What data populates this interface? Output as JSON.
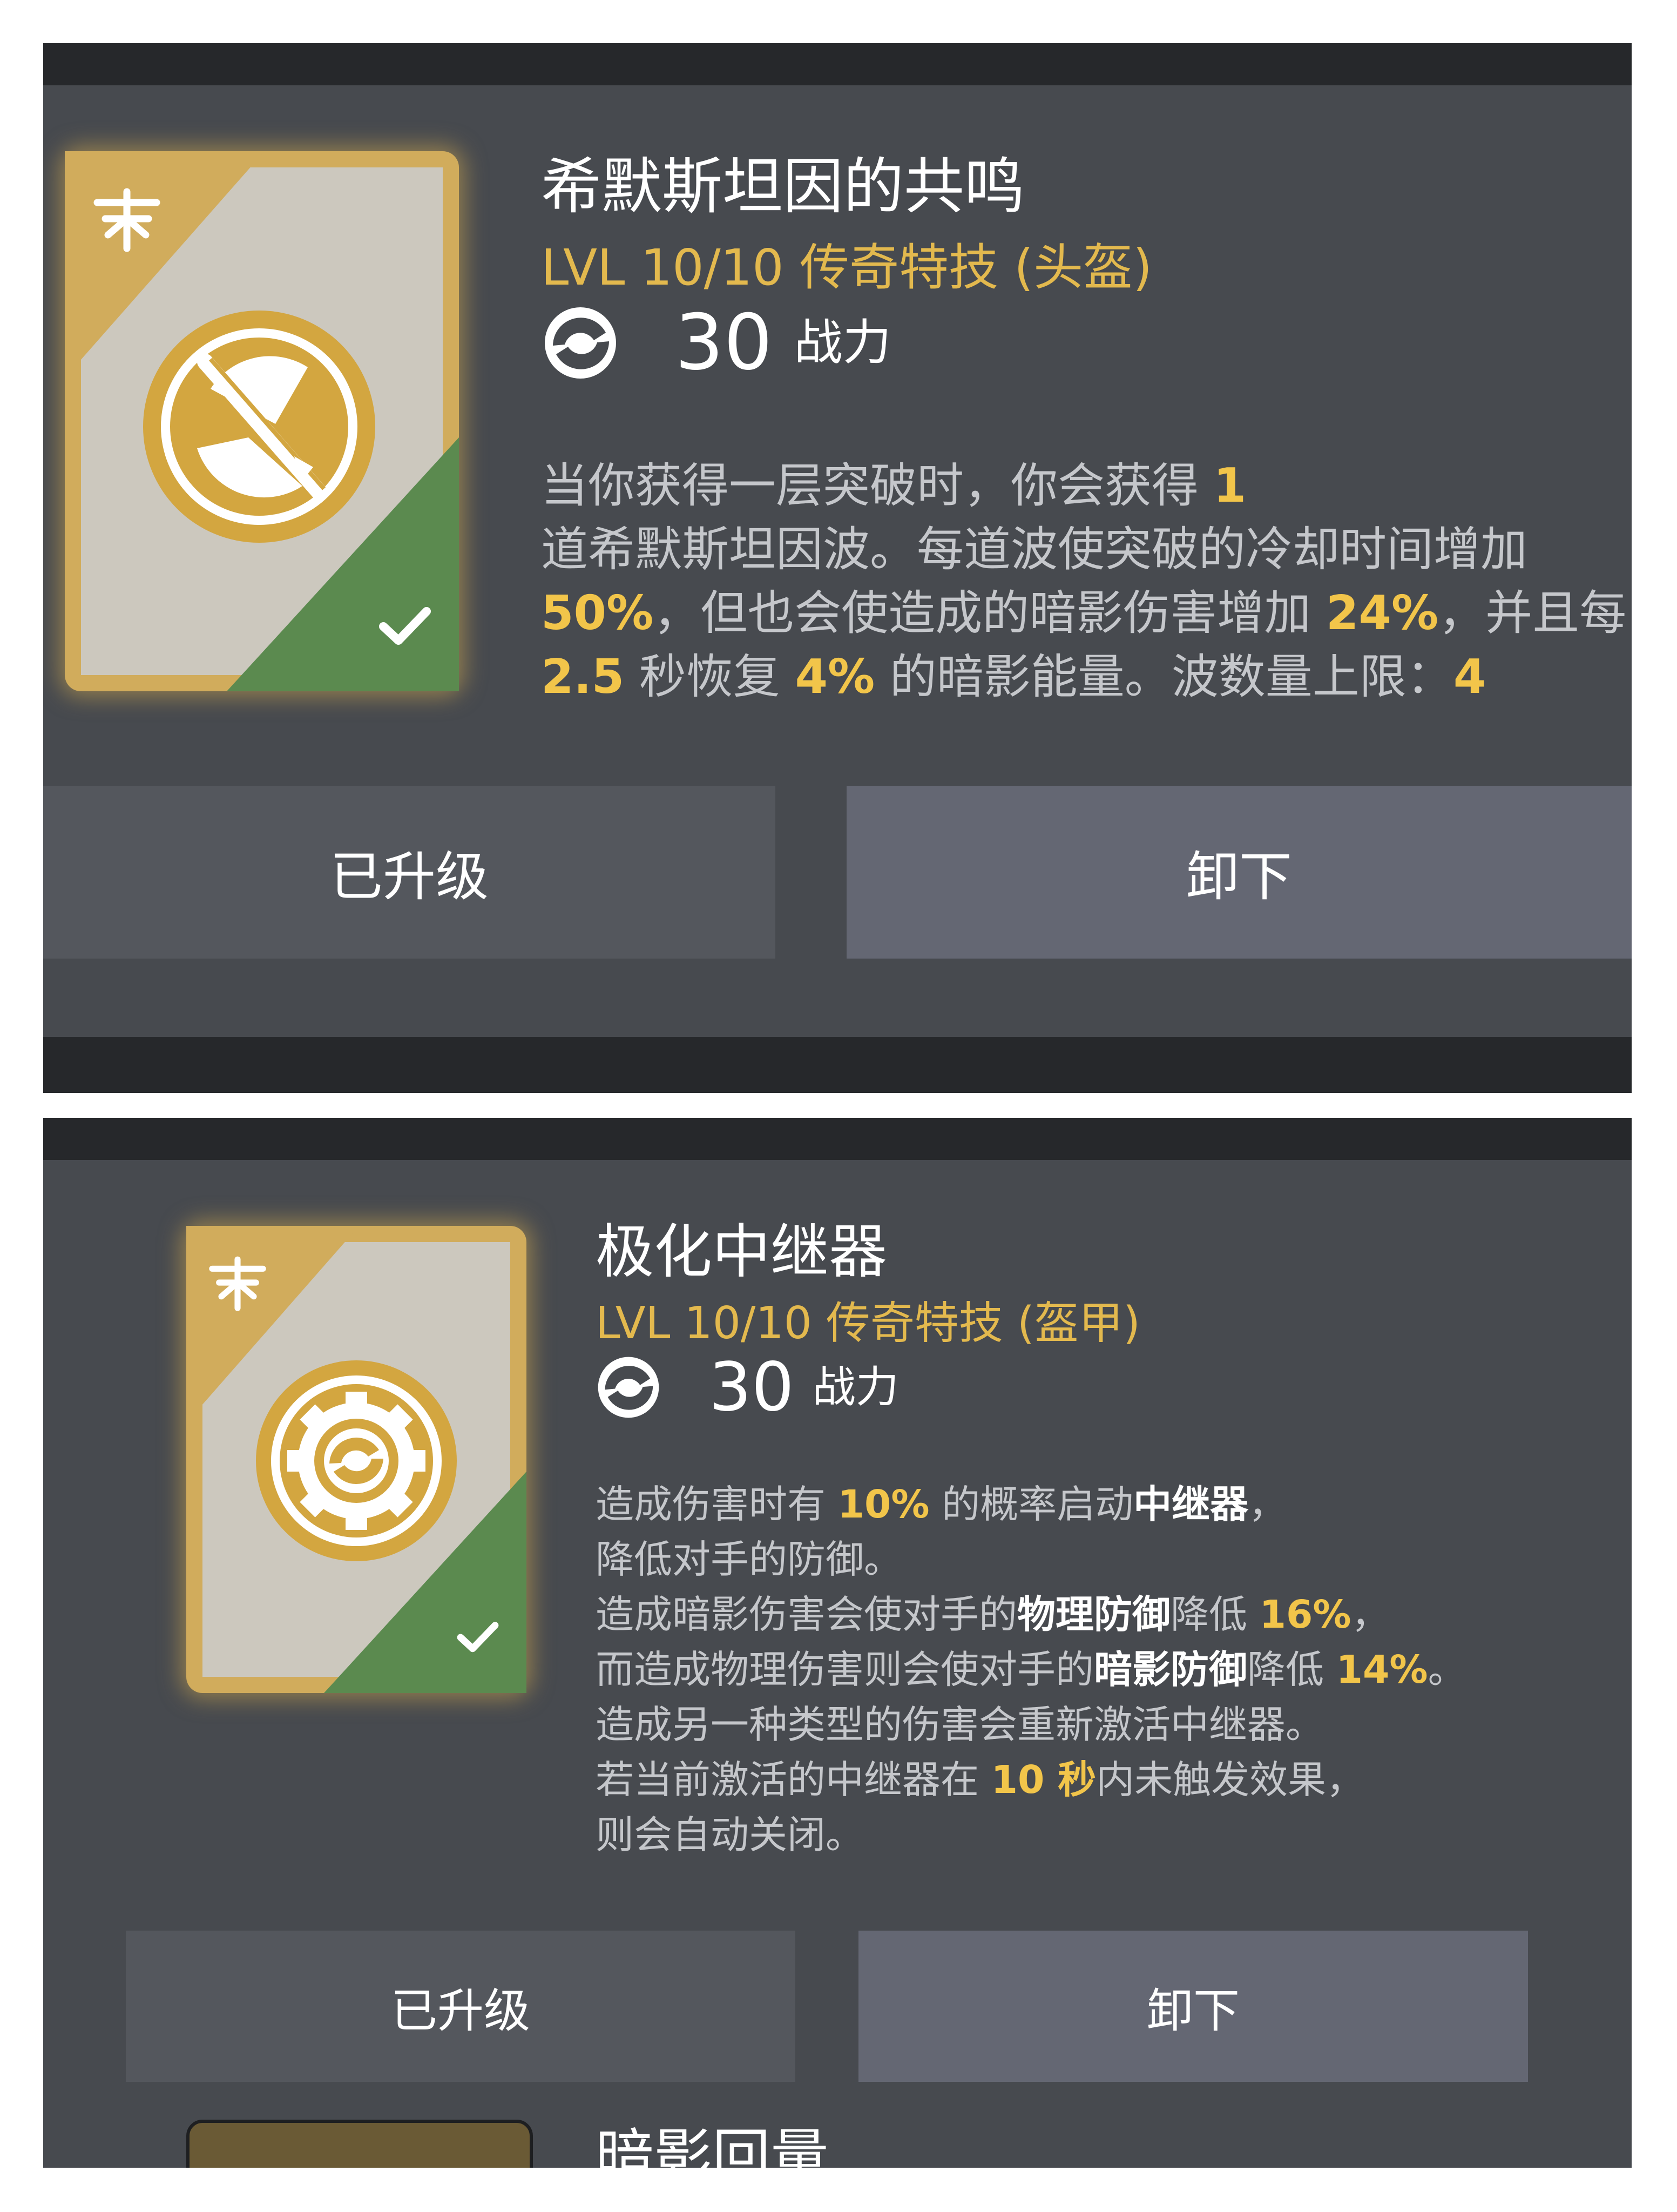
{
  "cards": [
    {
      "title": "希默斯坦因的共鸣",
      "level": "LVL 10/10 传奇特技 (头盔)",
      "power_value": "30",
      "power_label": "战力",
      "description_lines": [
        [
          {
            "t": "当你获得一层突破时，你会获得 "
          },
          {
            "t": "1",
            "hl": true
          }
        ],
        [
          {
            "t": "道希默斯坦因波。每道波使突破的冷却时间增加"
          }
        ],
        [
          {
            "t": "50%",
            "hl": true
          },
          {
            "t": "，但也会使造成的暗影伤害增加 "
          },
          {
            "t": "24%",
            "hl": true
          },
          {
            "t": "，并且每"
          }
        ],
        [
          {
            "t": "2.5",
            "hl": true
          },
          {
            "t": " 秒恢复 "
          },
          {
            "t": "4%",
            "hl": true
          },
          {
            "t": " 的暗影能量。波数量上限："
          },
          {
            "t": "4",
            "hl": true
          }
        ]
      ],
      "buttons": {
        "upgraded": "已升级",
        "unequip": "卸下"
      },
      "icon": "crossed-weapons-emblem-icon",
      "equipped": true
    },
    {
      "title": "极化中继器",
      "level": "LVL 10/10 传奇特技 (盔甲)",
      "power_value": "30",
      "power_label": "战力",
      "description_lines": [
        [
          {
            "t": "造成伤害时有 "
          },
          {
            "t": "10%",
            "hl": true
          },
          {
            "t": " 的概率启动"
          },
          {
            "t": "中继器",
            "bw": true
          },
          {
            "t": "，"
          }
        ],
        [
          {
            "t": "降低对手的防御。"
          }
        ],
        [
          {
            "t": "造成暗影伤害会使对手的"
          },
          {
            "t": "物理防御",
            "bw": true
          },
          {
            "t": "降低 "
          },
          {
            "t": "16%",
            "hl": true
          },
          {
            "t": "，"
          }
        ],
        [
          {
            "t": "而造成物理伤害则会使对手的"
          },
          {
            "t": "暗影防御",
            "bw": true
          },
          {
            "t": "降低 "
          },
          {
            "t": "14%",
            "hl": true
          },
          {
            "t": "。"
          }
        ],
        [
          {
            "t": "造成另一种类型的伤害会重新激活中继器。"
          }
        ],
        [
          {
            "t": "若当前激活的中继器在 "
          },
          {
            "t": "10 秒",
            "hl": true
          },
          {
            "t": "内未触发效果，"
          }
        ],
        [
          {
            "t": "则会自动关闭。"
          }
        ]
      ],
      "buttons": {
        "upgraded": "已升级",
        "unequip": "卸下"
      },
      "icon": "gear-emblem-icon",
      "equipped": true
    }
  ],
  "next_item_title": "暗影回量",
  "colors": {
    "panel": "#474a4f",
    "bar": "#26282b",
    "gold_text": "#e3b94e",
    "highlight": "#f2c54a",
    "body_text": "#c5c7cb",
    "card_gold": "#d1ac5c",
    "equipped_green": "#5b8a4f"
  }
}
